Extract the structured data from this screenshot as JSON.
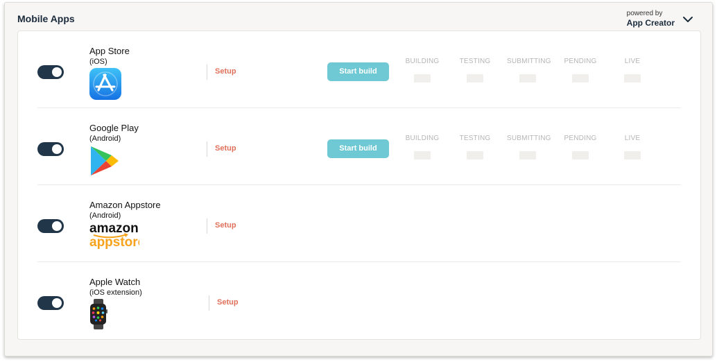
{
  "header": {
    "title": "Mobile Apps",
    "powered_by": "powered by",
    "brand": "App Creator"
  },
  "stages": [
    "BUILDING",
    "TESTING",
    "SUBMITTING",
    "PENDING",
    "LIVE"
  ],
  "apps": [
    {
      "name": "App Store",
      "platform": "(iOS)",
      "setup_label": "Setup",
      "build_label": "Start build",
      "enabled": true
    },
    {
      "name": "Google Play",
      "platform": "(Android)",
      "setup_label": "Setup",
      "build_label": "Start build",
      "enabled": true
    },
    {
      "name": "Amazon Appstore",
      "platform": "(Android)",
      "setup_label": "Setup",
      "logo_text_1": "amazon",
      "logo_text_2": "appstore",
      "enabled": true
    },
    {
      "name": "Apple Watch",
      "platform": "(iOS extension)",
      "setup_label": "Setup",
      "enabled": true
    }
  ],
  "colors": {
    "toggle_on": "#213649",
    "setup_link": "#e0705a",
    "build_button": "#6ec9d4",
    "title": "#1b2b3c"
  },
  "icons": [
    "chevron-down-icon",
    "app-store-icon",
    "google-play-icon",
    "amazon-appstore-logo",
    "apple-watch-icon"
  ]
}
